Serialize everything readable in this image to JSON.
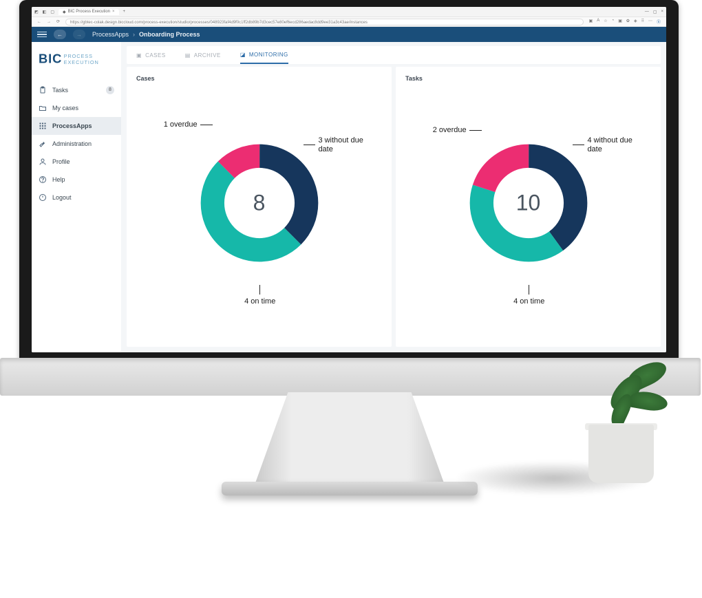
{
  "browser": {
    "tab_title": "BIC Process Execution",
    "address": "https://gbtec-colak.design.biccloud.com/process-execution/studio/processes/048923faf4d9f0c1ff2db89b7d3cec57e80ef6ecd286aedac8dd9ee31a3c43ae/instances"
  },
  "header": {
    "breadcrumb_root": "ProcessApps",
    "breadcrumb_current": "Onboarding Process"
  },
  "brand": {
    "line1": "BIC",
    "line2a": "PROCESS",
    "line2b": "EXECUTION"
  },
  "sidebar": {
    "items": [
      {
        "label": "Tasks",
        "badge": "8"
      },
      {
        "label": "My cases"
      },
      {
        "label": "ProcessApps"
      },
      {
        "label": "Administration"
      },
      {
        "label": "Profile"
      },
      {
        "label": "Help"
      },
      {
        "label": "Logout"
      }
    ]
  },
  "tabs": {
    "cases": "CASES",
    "archive": "ARCHIVE",
    "monitoring": "MONITORING"
  },
  "panels": {
    "cases": {
      "title": "Cases",
      "total": "8"
    },
    "tasks": {
      "title": "Tasks",
      "total": "10"
    }
  },
  "colors": {
    "navy": "#16365c",
    "pink": "#ec2d72",
    "teal": "#16b8a9"
  },
  "chart_data": [
    {
      "type": "pie",
      "title": "Cases",
      "total": 8,
      "series": [
        {
          "name": "Cases",
          "values": [
            3,
            4,
            1
          ]
        }
      ],
      "categories": [
        "without due date",
        "on time",
        "overdue"
      ],
      "labels": [
        "3 without due date",
        "4 on time",
        "1 overdue"
      ],
      "colors": [
        "#16365c",
        "#16b8a9",
        "#ec2d72"
      ]
    },
    {
      "type": "pie",
      "title": "Tasks",
      "total": 10,
      "series": [
        {
          "name": "Tasks",
          "values": [
            4,
            4,
            2
          ]
        }
      ],
      "categories": [
        "without due date",
        "on time",
        "overdue"
      ],
      "labels": [
        "4 without due date",
        "4 on time",
        "2 overdue"
      ],
      "colors": [
        "#16365c",
        "#16b8a9",
        "#ec2d72"
      ]
    }
  ]
}
